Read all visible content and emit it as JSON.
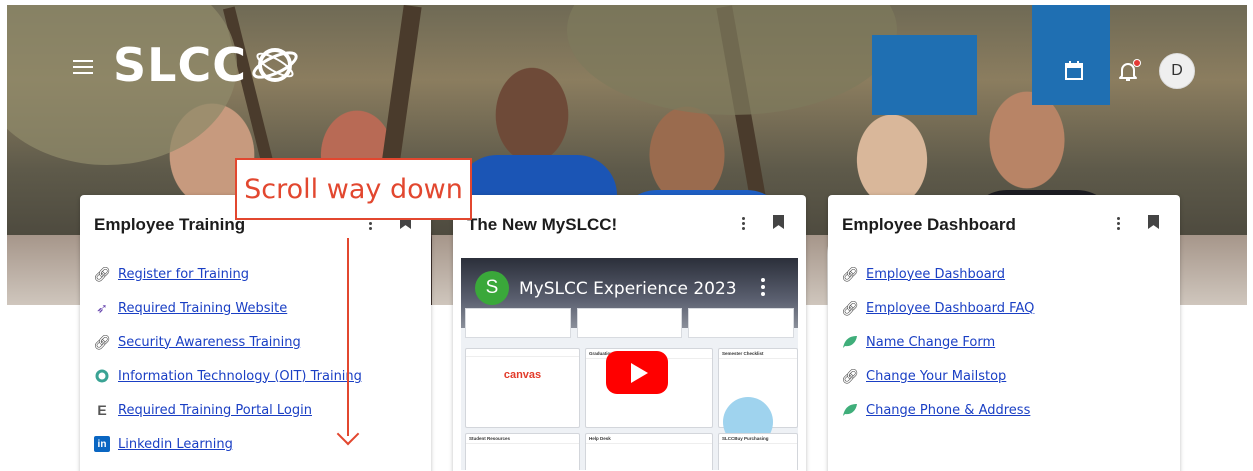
{
  "header": {
    "logo_text": "SLCC",
    "avatar_initial": "D",
    "accent": "#1f6fb2",
    "icons": [
      "menu-icon",
      "calendar-icon",
      "bell-icon"
    ]
  },
  "annotation": {
    "text": "Scroll way down",
    "color": "#e2472f"
  },
  "cards": {
    "training": {
      "title": "Employee Training",
      "links": [
        {
          "label": "Register for Training",
          "icon": "link-icon"
        },
        {
          "label": "Required Training Website",
          "icon": "training-site-icon"
        },
        {
          "label": "Security Awareness Training",
          "icon": "link-icon"
        },
        {
          "label": "Information Technology (OIT) Training",
          "icon": "oit-icon"
        },
        {
          "label": "Required Training Portal Login",
          "icon": "e-icon"
        },
        {
          "label": "Linkedin Learning",
          "icon": "linkedin-icon"
        }
      ]
    },
    "myslcc": {
      "title": "The New MySLCC!",
      "video": {
        "channel_initial": "S",
        "title": "MySLCC Experience 2023",
        "canvas_label": "canvas",
        "tiles": [
          "Graduation",
          "Semester Checklist",
          "Student Resources",
          "Help Desk",
          "SLCCBuy Purchasing"
        ]
      }
    },
    "dashboard": {
      "title": "Employee Dashboard",
      "links": [
        {
          "label": "Employee Dashboard",
          "icon": "link-icon"
        },
        {
          "label": "Employee Dashboard FAQ",
          "icon": "link-icon"
        },
        {
          "label": "Name Change Form",
          "icon": "leaf-icon"
        },
        {
          "label": "Change Your Mailstop",
          "icon": "link-icon"
        },
        {
          "label": "Change Phone & Address",
          "icon": "leaf-icon"
        }
      ]
    }
  }
}
